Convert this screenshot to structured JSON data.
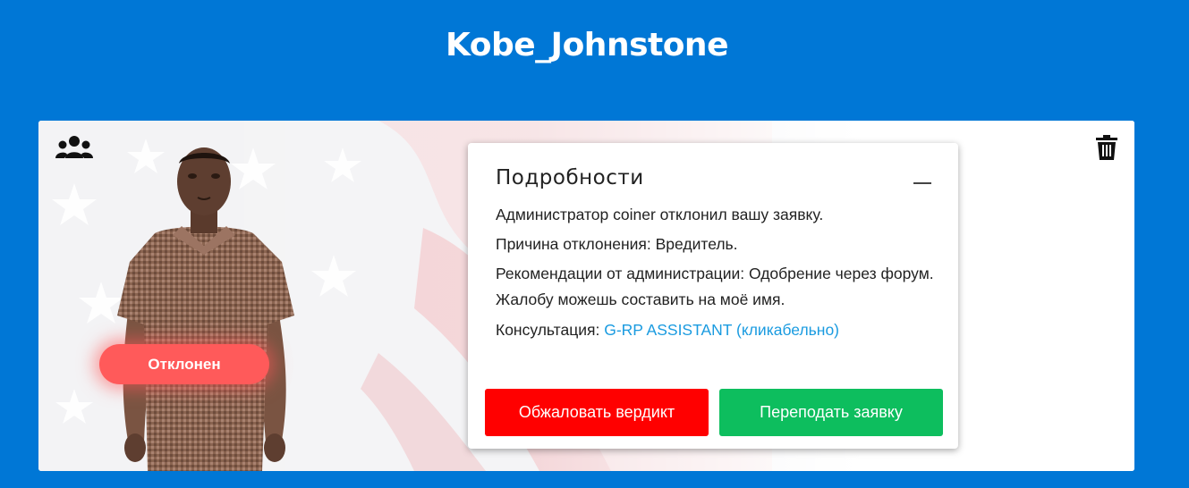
{
  "header": {
    "title": "Kobe_Johnstone"
  },
  "card": {
    "group_icon": "users-group-icon",
    "delete_icon": "trash-icon",
    "status_badge": "Отклонен",
    "details": {
      "title": "Подробности",
      "collapse_icon": "minus-icon",
      "line_admin": "Администратор coiner отклонил вашу заявку.",
      "line_reason": "Причина отклонения: Вредитель.",
      "line_recommendations": "Рекомендации от администрации: Одобрение через форум. Жалобу можешь составить на моё имя.",
      "consult_label": "Консультация: ",
      "consult_link": "G-RP ASSISTANT (кликабельно)",
      "appeal_button": "Обжаловать вердикт",
      "resubmit_button": "Переподать заявку"
    }
  },
  "colors": {
    "page_bg": "#0077D6",
    "status_rejected": "#FF5A5A",
    "appeal_button": "#FF0000",
    "resubmit_button": "#0DBE5E",
    "link": "#1A9BE0"
  }
}
